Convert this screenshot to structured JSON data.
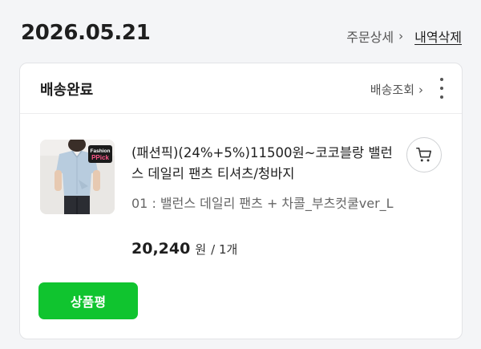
{
  "order": {
    "date": "2026.05.21",
    "detail_label": "주문상세",
    "detail_chevron": "›",
    "delete_label": "내역삭제"
  },
  "card": {
    "status": "배송완료",
    "track_label": "배송조회",
    "track_chevron": "›",
    "more_icon": "more-vertical-icon"
  },
  "product": {
    "thumbnail_badge_line1": "Fashion",
    "thumbnail_badge_line2": "PPick",
    "name": "(패션픽)(24%+5%)11500원~코코블랑 밸런스 데일리 팬츠 티셔츠/청바지",
    "option": "01 : 밸런스 데일리 팬츠 + 차콜_부츠컷쿨ver_L",
    "price": "20,240",
    "price_unit": "원",
    "quantity": "/ 1개",
    "cart_icon": "cart-icon"
  },
  "actions": {
    "review_label": "상품평"
  },
  "colors": {
    "accent_green": "#10c42f",
    "background": "#f4f5f7"
  }
}
